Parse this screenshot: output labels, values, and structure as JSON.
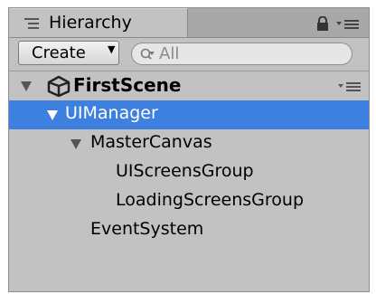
{
  "window": {
    "tab_title": "Hierarchy",
    "tab_icon": "hierarchy-list-icon",
    "lock_icon": "lock-icon",
    "menu_icon": "context-menu-icon"
  },
  "toolbar": {
    "create_label": "Create",
    "create_arrow": "▼",
    "search_placeholder": "All",
    "search_icon": "search-filter-icon"
  },
  "hierarchy": {
    "scene": {
      "name": "FirstScene",
      "icon": "unity-logo-icon",
      "expanded": true
    },
    "items": [
      {
        "label": "UIManager",
        "depth": 1,
        "expanded": true,
        "selected": true
      },
      {
        "label": "MasterCanvas",
        "depth": 2,
        "expanded": true,
        "selected": false
      },
      {
        "label": "UIScreensGroup",
        "depth": 3,
        "expanded": false,
        "selected": false
      },
      {
        "label": "LoadingScreensGroup",
        "depth": 3,
        "expanded": false,
        "selected": false
      },
      {
        "label": "EventSystem",
        "depth": 2,
        "expanded": false,
        "selected": false
      }
    ]
  },
  "colors": {
    "panel_bg": "#c2c2c2",
    "selection": "#3d80df",
    "selected_text": "#ffffff"
  }
}
